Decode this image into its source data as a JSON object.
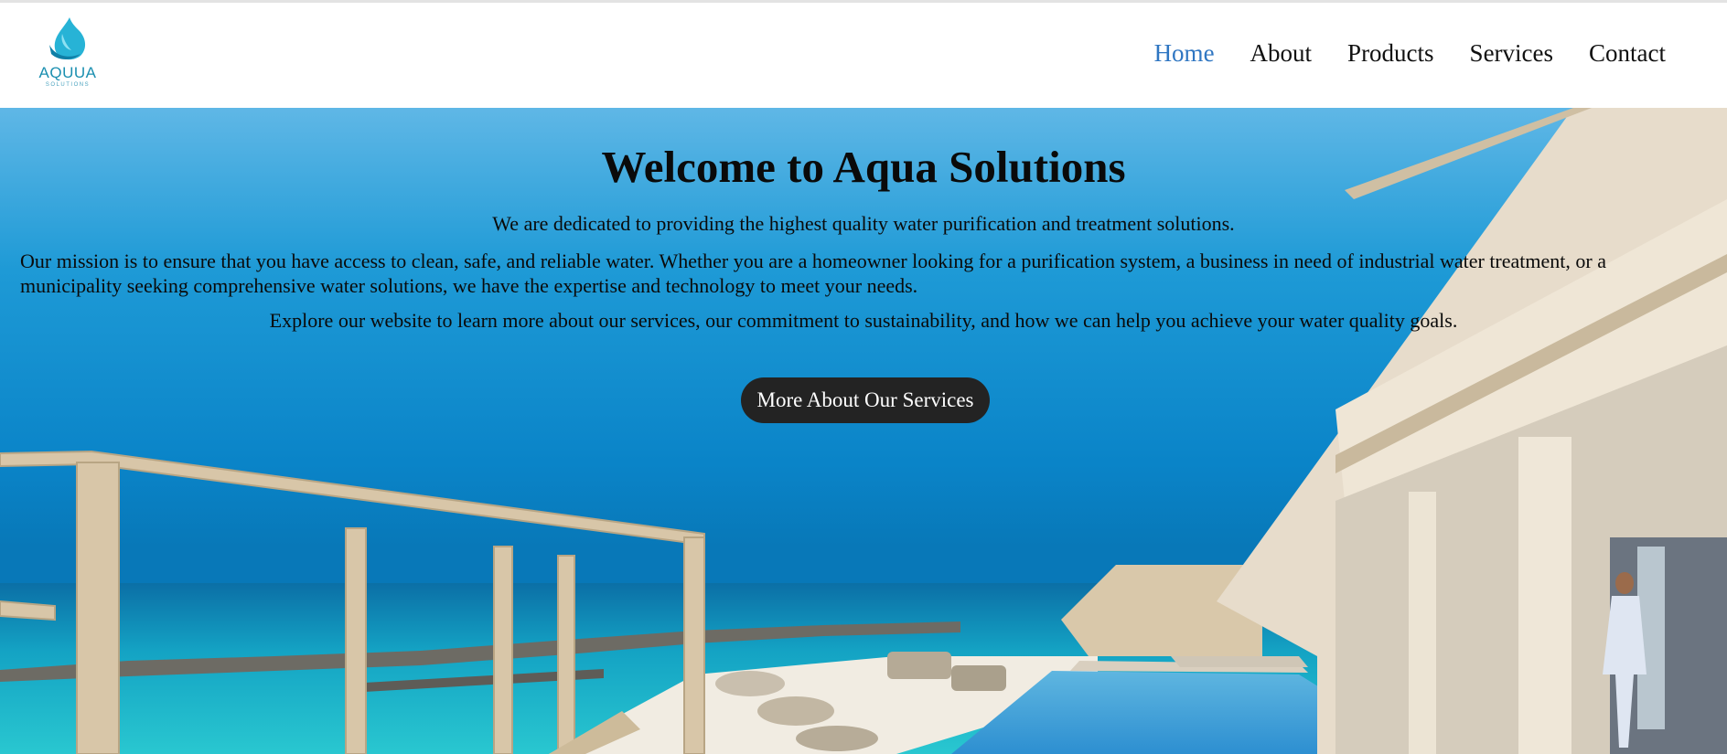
{
  "brand": {
    "name": "AQUUA",
    "tagline": "SOLUTIONS",
    "logo_icon": "water-drop-icon",
    "color": "#1b8fb0"
  },
  "nav": {
    "items": [
      {
        "label": "Home",
        "active": true
      },
      {
        "label": "About",
        "active": false
      },
      {
        "label": "Products",
        "active": false
      },
      {
        "label": "Services",
        "active": false
      },
      {
        "label": "Contact",
        "active": false
      }
    ],
    "active_color": "#2f76c2"
  },
  "hero": {
    "title": "Welcome to Aqua Solutions",
    "line1": "We are dedicated to providing the highest quality water purification and treatment solutions.",
    "line2": "Our mission is to ensure that you have access to clean, safe, and reliable water. Whether you are a homeowner looking for a purification system, a business in need of industrial water treatment, or a municipality seeking comprehensive water solutions, we have the expertise and technology to meet your needs.",
    "line3": "Explore our website to learn more about our services, our commitment to sustainability, and how we can help you achieve your water quality goals.",
    "cta_label": "More About Our Services",
    "background": "resort-ocean-pool-photo"
  }
}
